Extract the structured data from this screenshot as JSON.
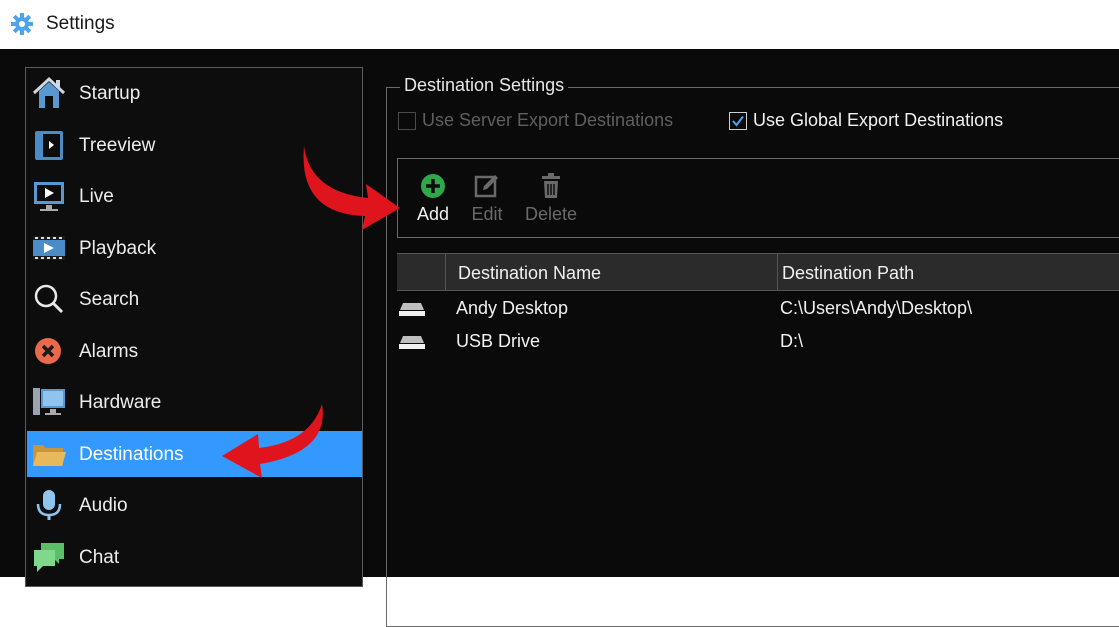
{
  "window": {
    "title": "Settings",
    "icon": "gear-icon"
  },
  "sidebar": {
    "items": [
      {
        "label": "Startup",
        "icon": "home-icon"
      },
      {
        "label": "Treeview",
        "icon": "treeview-icon"
      },
      {
        "label": "Live",
        "icon": "live-monitor-icon"
      },
      {
        "label": "Playback",
        "icon": "film-icon"
      },
      {
        "label": "Search",
        "icon": "search-icon"
      },
      {
        "label": "Alarms",
        "icon": "alarm-x-icon"
      },
      {
        "label": "Hardware",
        "icon": "hardware-icon"
      },
      {
        "label": "Destinations",
        "icon": "folder-icon",
        "selected": true
      },
      {
        "label": "Audio",
        "icon": "microphone-icon"
      },
      {
        "label": "Chat",
        "icon": "chat-icon"
      }
    ]
  },
  "destination_settings": {
    "group_title": "Destination Settings",
    "server_export": {
      "label": "Use Server Export Destinations",
      "checked": false,
      "enabled": false
    },
    "global_export": {
      "label": "Use Global Export Destinations",
      "checked": true,
      "enabled": true
    }
  },
  "toolbar": {
    "add_label": "Add",
    "edit_label": "Edit",
    "delete_label": "Delete"
  },
  "table": {
    "columns": [
      "Destination Name",
      "Destination Path"
    ],
    "rows": [
      {
        "name": "Andy Desktop",
        "path": "C:\\Users\\Andy\\Desktop\\"
      },
      {
        "name": "USB Drive",
        "path": "D:\\"
      }
    ]
  },
  "colors": {
    "selection": "#3399ff",
    "background": "#0a0a0a",
    "add_icon": "#2ea84a",
    "annotation_arrow": "#e0141c"
  }
}
